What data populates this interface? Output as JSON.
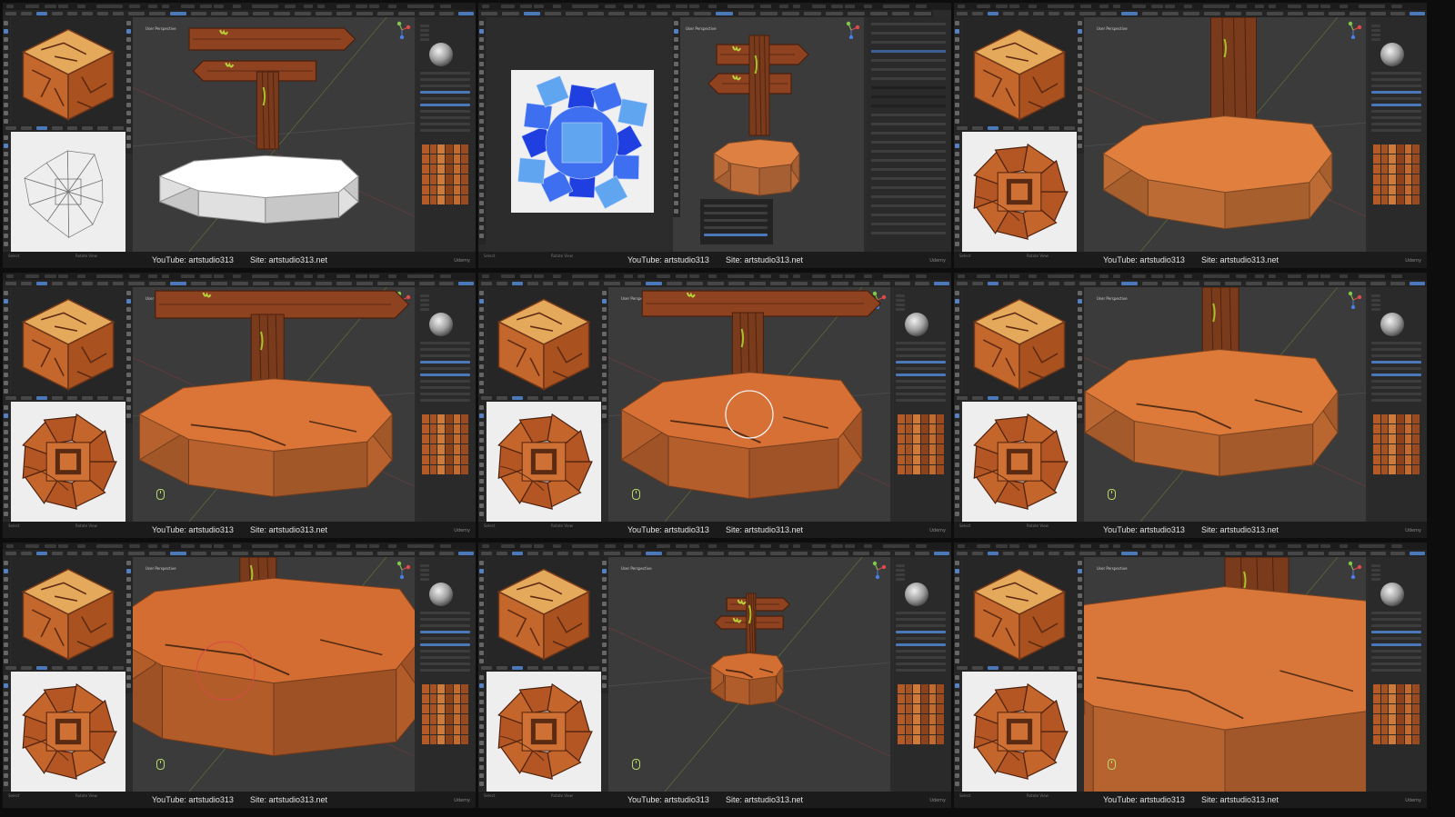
{
  "credits": {
    "youtube": "YouTube: artstudio313",
    "site": "Site: artstudio313.net"
  },
  "platform": "Udemy",
  "tiles": [
    {
      "id": "r1c1",
      "model": "sign-base-white",
      "image_editor": "uv-wireframe",
      "color": "#ffffff",
      "gizmo": true,
      "mouse_icon": false,
      "viewport_label": "User Perspective"
    },
    {
      "id": "r1c2",
      "layout": "uv-editor",
      "uv_colors": [
        "#1f3fe0",
        "#3d6ff0",
        "#5fa5f0"
      ],
      "tool_panel_label": "Select",
      "viewport_label": "User Perspective"
    },
    {
      "id": "r1c3",
      "model": "base-closeup",
      "image_editor": "painted-atlas",
      "color": "#d67a3b",
      "gizmo": true,
      "mouse_icon": false,
      "viewport_label": "User Perspective"
    },
    {
      "id": "r2c1",
      "model": "base-painted",
      "image_editor": "painted-atlas",
      "color": "#d06f34",
      "gizmo": true,
      "mouse_icon": true,
      "viewport_label": "User Perspective"
    },
    {
      "id": "r2c2",
      "model": "base-painted-brush",
      "image_editor": "painted-atlas",
      "color": "#cc6b32",
      "gizmo": true,
      "mouse_icon": true,
      "viewport_label": "User Perspective"
    },
    {
      "id": "r2c3",
      "model": "base-top",
      "image_editor": "painted-atlas",
      "color": "#d27436",
      "gizmo": true,
      "mouse_icon": true,
      "viewport_label": "User Perspective"
    },
    {
      "id": "r3c1",
      "model": "base-macro",
      "image_editor": "painted-atlas",
      "color": "#c9682f",
      "gizmo": true,
      "mouse_icon": true,
      "viewport_label": "User Perspective"
    },
    {
      "id": "r3c2",
      "model": "sign-far",
      "image_editor": "painted-atlas",
      "color": "#c96a31",
      "gizmo": true,
      "mouse_icon": true,
      "viewport_label": "User Perspective"
    },
    {
      "id": "r3c3",
      "model": "base-macro2",
      "image_editor": "painted-atlas",
      "color": "#cf7036",
      "gizmo": true,
      "mouse_icon": true,
      "viewport_label": "User Perspective"
    }
  ],
  "status_left": "Select",
  "status_mid": "Rotate View",
  "palette": {
    "viewport": "#3b3b3b",
    "panel": "#2a2a2a",
    "accent": "#4a78b8",
    "orange": "#d06f34",
    "bark": "#7a3a1c",
    "moss": "#a9c12a",
    "stone": "#c97a3a"
  }
}
